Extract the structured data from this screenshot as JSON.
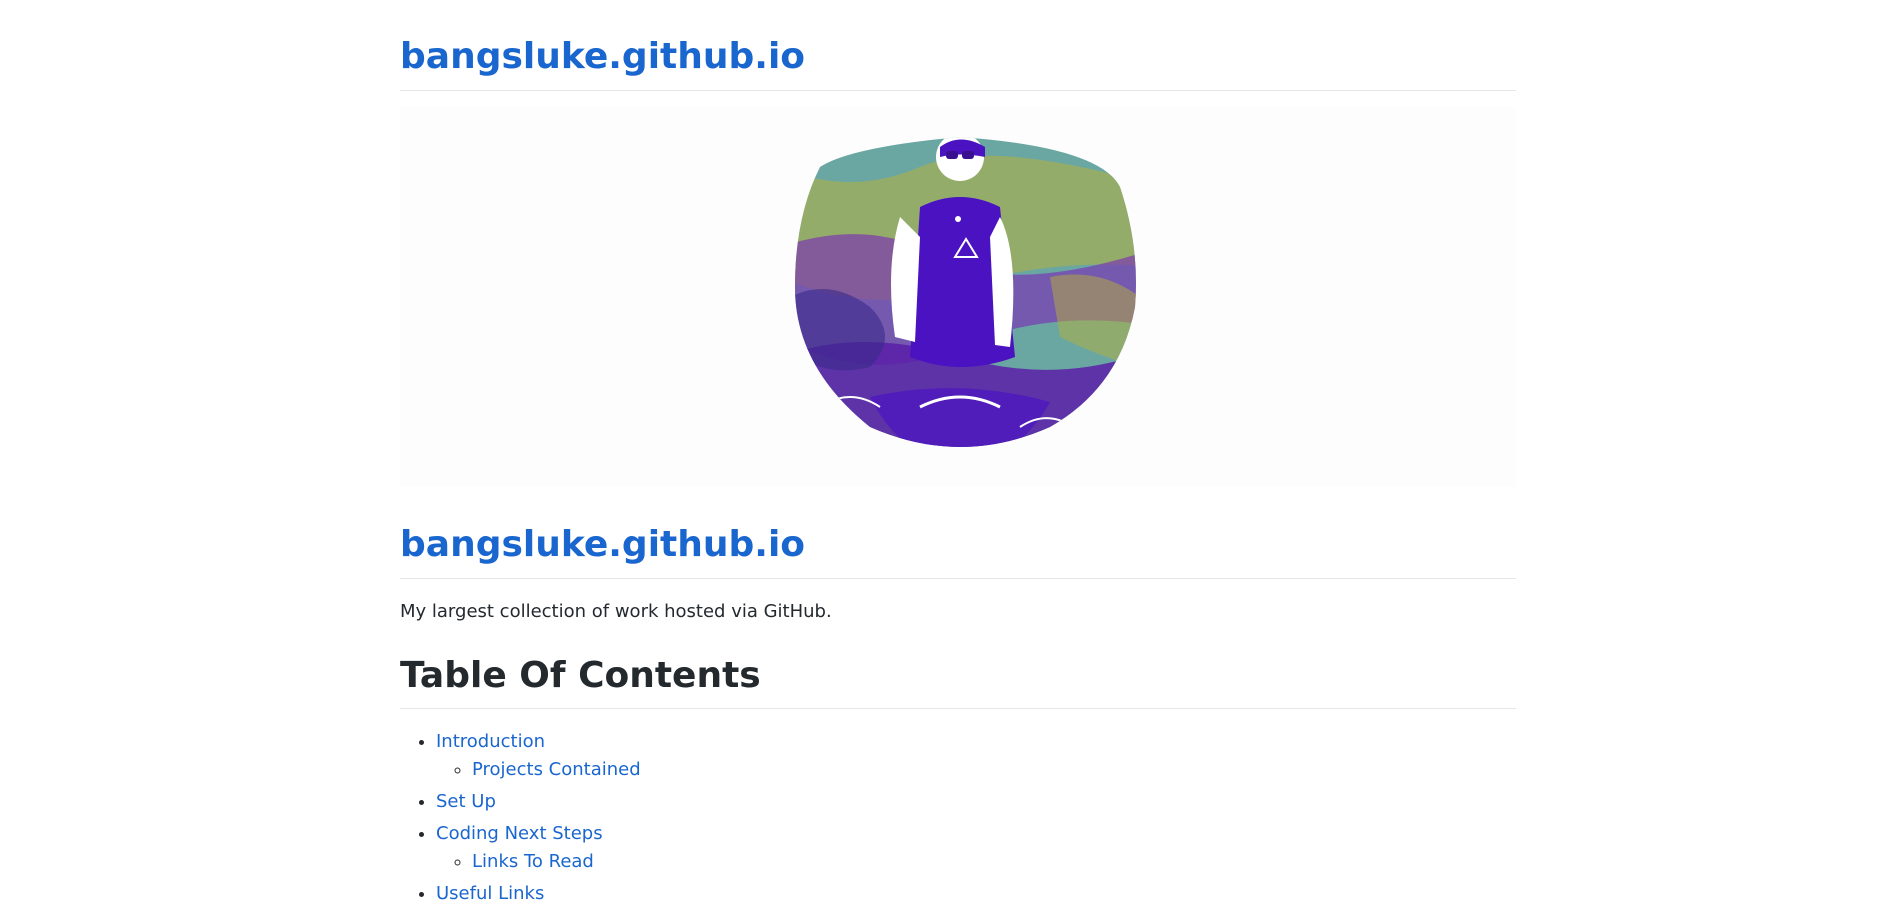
{
  "header": {
    "site_title": "bangsluke.github.io"
  },
  "hero": {
    "image_alt": "stylized profile photo",
    "palette": {
      "purple": "#4b12c2",
      "teal": "#4fa0a0",
      "olive": "#b6b03a",
      "violet": "#7a2fb5"
    }
  },
  "main": {
    "heading": "bangsluke.github.io",
    "description": "My largest collection of work hosted via GitHub.",
    "toc_title": "Table Of Contents",
    "toc": [
      {
        "label": "Introduction",
        "children": [
          {
            "label": "Projects Contained"
          }
        ]
      },
      {
        "label": "Set Up",
        "children": []
      },
      {
        "label": "Coding Next Steps",
        "children": [
          {
            "label": "Links To Read"
          }
        ]
      },
      {
        "label": "Useful Links",
        "children": []
      }
    ]
  },
  "colors": {
    "link": "#1a66cf",
    "text": "#24292e",
    "divider": "#e5e7ea"
  }
}
